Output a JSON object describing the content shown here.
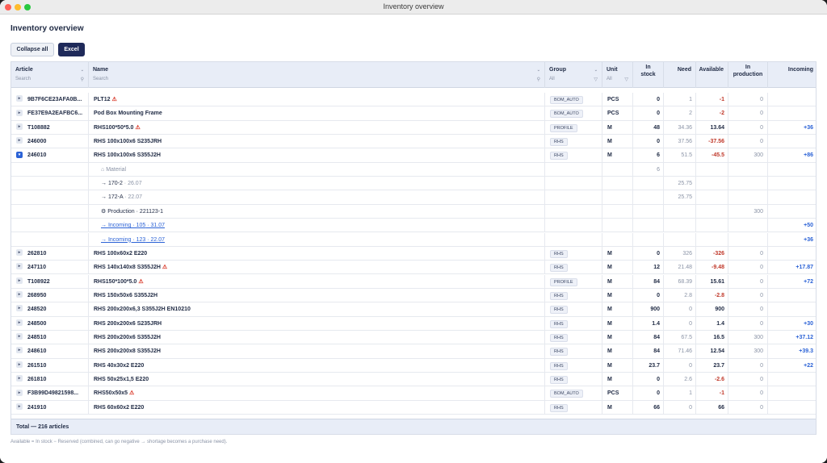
{
  "window": {
    "title": "Inventory overview"
  },
  "page": {
    "title": "Inventory overview"
  },
  "toolbar": {
    "collapse_label": "Collapse all",
    "excel_label": "Excel"
  },
  "columns": {
    "article": {
      "label": "Article",
      "placeholder": "Search"
    },
    "name": {
      "label": "Name",
      "placeholder": "Search"
    },
    "group": {
      "label": "Group",
      "placeholder": "All"
    },
    "unit": {
      "label": "Unit",
      "placeholder": "All"
    },
    "stock": {
      "label_1": "In",
      "label_2": "stock"
    },
    "need": {
      "label": "Need"
    },
    "available": {
      "label": "Available"
    },
    "production": {
      "label_1": "In",
      "label_2": "production"
    },
    "incoming": {
      "label": "Incoming"
    }
  },
  "rows": [
    {
      "article": "9B7F6CE23AFA0B...",
      "name": "PLT12",
      "warn": true,
      "group": "BOM_AUTO",
      "unit": "PCS",
      "stock": "0",
      "need": "1",
      "available": "-1",
      "production": "0",
      "incoming": ""
    },
    {
      "article": "FE37E9A2EAFBC6...",
      "name": "Pod Box Mounting Frame",
      "warn": false,
      "group": "BOM_AUTO",
      "unit": "PCS",
      "stock": "0",
      "need": "2",
      "available": "-2",
      "production": "0",
      "incoming": ""
    },
    {
      "article": "T108882",
      "name": "RHS100*50*5.0",
      "warn": true,
      "group": "PROFILE",
      "unit": "M",
      "stock": "48",
      "need": "34.36",
      "available": "13.64",
      "production": "0",
      "incoming": "+36"
    },
    {
      "article": "246000",
      "name": "RHS 100x100x6 S235JRH",
      "warn": false,
      "group": "RHS",
      "unit": "M",
      "stock": "0",
      "need": "37.56",
      "available": "-37.56",
      "production": "0",
      "incoming": ""
    },
    {
      "article": "246010",
      "name": "RHS 100x100x6 S355J2H",
      "warn": false,
      "group": "RHS",
      "unit": "M",
      "stock": "6",
      "need": "51.5",
      "available": "-45.5",
      "production": "300",
      "incoming": "+86",
      "expanded": true
    },
    {
      "article": "262810",
      "name": "RHS 100x60x2 E220",
      "warn": false,
      "group": "RHS",
      "unit": "M",
      "stock": "0",
      "need": "326",
      "available": "-326",
      "production": "0",
      "incoming": ""
    },
    {
      "article": "247110",
      "name": "RHS 140x140x8 S355J2H",
      "warn": true,
      "group": "RHS",
      "unit": "M",
      "stock": "12",
      "need": "21.48",
      "available": "-9.48",
      "production": "0",
      "incoming": "+17.87"
    },
    {
      "article": "T108922",
      "name": "RHS150*100*5.0",
      "warn": true,
      "group": "PROFILE",
      "unit": "M",
      "stock": "84",
      "need": "68.39",
      "available": "15.61",
      "production": "0",
      "incoming": "+72"
    },
    {
      "article": "268950",
      "name": "RHS 150x50x6 S355J2H",
      "warn": false,
      "group": "RHS",
      "unit": "M",
      "stock": "0",
      "need": "2.8",
      "available": "-2.8",
      "production": "0",
      "incoming": ""
    },
    {
      "article": "248520",
      "name": "RHS 200x200x6,3 S355J2H EN10210",
      "warn": false,
      "group": "RHS",
      "unit": "M",
      "stock": "900",
      "need": "0",
      "available": "900",
      "production": "0",
      "incoming": ""
    },
    {
      "article": "248500",
      "name": "RHS 200x200x6 S235JRH",
      "warn": false,
      "group": "RHS",
      "unit": "M",
      "stock": "1.4",
      "need": "0",
      "available": "1.4",
      "production": "0",
      "incoming": "+30"
    },
    {
      "article": "248510",
      "name": "RHS 200x200x6 S355J2H",
      "warn": false,
      "group": "RHS",
      "unit": "M",
      "stock": "84",
      "need": "67.5",
      "available": "16.5",
      "production": "300",
      "incoming": "+37.12"
    },
    {
      "article": "248610",
      "name": "RHS 200x200x8 S355J2H",
      "warn": false,
      "group": "RHS",
      "unit": "M",
      "stock": "84",
      "need": "71.46",
      "available": "12.54",
      "production": "300",
      "incoming": "+39.3"
    },
    {
      "article": "261510",
      "name": "RHS 40x30x2 E220",
      "warn": false,
      "group": "RHS",
      "unit": "M",
      "stock": "23.7",
      "need": "0",
      "available": "23.7",
      "production": "0",
      "incoming": "+22"
    },
    {
      "article": "261810",
      "name": "RHS 50x25x1,5 E220",
      "warn": false,
      "group": "RHS",
      "unit": "M",
      "stock": "0",
      "need": "2.6",
      "available": "-2.6",
      "production": "0",
      "incoming": ""
    },
    {
      "article": "F3B99D49821598...",
      "name": "RHS50x50x5",
      "warn": true,
      "group": "BOM_AUTO",
      "unit": "PCS",
      "stock": "0",
      "need": "1",
      "available": "-1",
      "production": "0",
      "incoming": ""
    },
    {
      "article": "241910",
      "name": "RHS 60x60x2 E220",
      "warn": false,
      "group": "RHS",
      "unit": "M",
      "stock": "66",
      "need": "0",
      "available": "66",
      "production": "0",
      "incoming": ""
    }
  ],
  "subrows": [
    {
      "prefix": "⌂",
      "label": "Material",
      "stock": "6",
      "need": "",
      "production": "",
      "incoming": ""
    },
    {
      "prefix": "→",
      "label": "170-2",
      "date": "26.07",
      "stock": "",
      "need": "25.75",
      "production": "",
      "incoming": ""
    },
    {
      "prefix": "→",
      "label": "172-A",
      "date": "22.07",
      "stock": "",
      "need": "25.75",
      "production": "",
      "incoming": ""
    },
    {
      "prefix": "⚙",
      "label": "Production · 221123-1",
      "stock": "",
      "need": "",
      "production": "300",
      "incoming": ""
    },
    {
      "prefix": "→",
      "label": "Incoming · 105",
      "date": "31.07",
      "link": true,
      "stock": "",
      "need": "",
      "production": "",
      "incoming": "+50"
    },
    {
      "prefix": "→",
      "label": "Incoming · 123",
      "date": "22.07",
      "link": true,
      "stock": "",
      "need": "",
      "production": "",
      "incoming": "+36"
    }
  ],
  "footer": {
    "total": "Total — 216 articles"
  },
  "note": "Available = In stock − Reserved (combined, can go negative → shortage becomes a purchase need)."
}
